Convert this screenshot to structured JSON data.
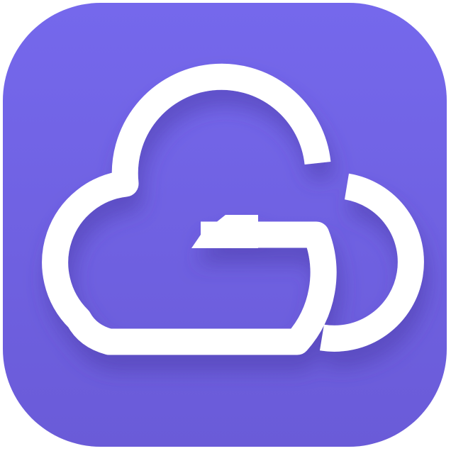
{
  "app_icon": {
    "name": "cloud-g-logo",
    "colors": {
      "tile_top": "#7568ec",
      "tile_bottom": "#6a5bd8",
      "glyph": "#ffffff",
      "shadow": "#4b3ba8"
    }
  }
}
